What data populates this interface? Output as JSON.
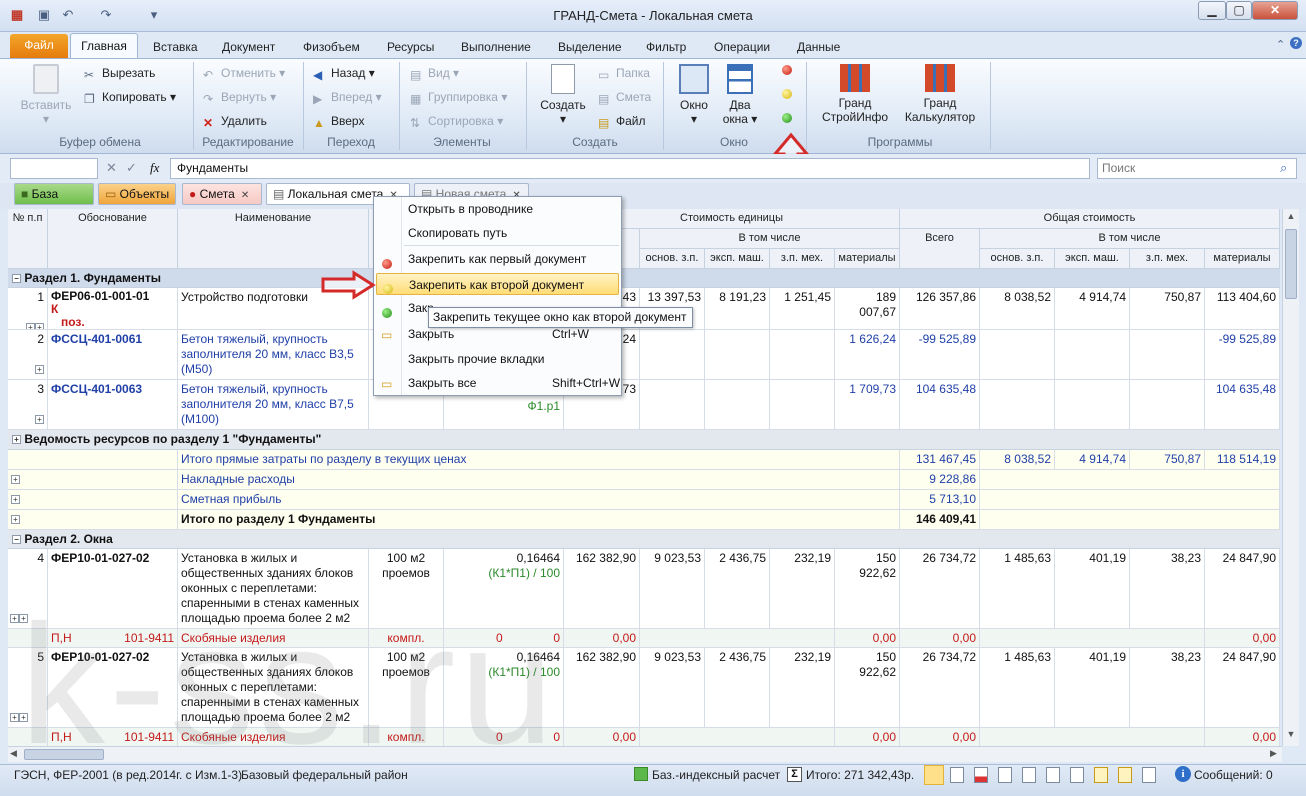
{
  "window": {
    "title": "ГРАНД-Смета - Локальная смета"
  },
  "ribbon_tabs": [
    "Файл",
    "Главная",
    "Вставка",
    "Документ",
    "Физобъем",
    "Ресурсы",
    "Выполнение",
    "Выделение",
    "Фильтр",
    "Операции",
    "Данные"
  ],
  "ribbon": {
    "clipboard": {
      "paste": "Вставить",
      "cut": "Вырезать",
      "copy": "Копировать",
      "label": "Буфер обмена"
    },
    "edit": {
      "undo": "Отменить",
      "redo": "Вернуть",
      "delete": "Удалить",
      "label": "Редактирование"
    },
    "nav": {
      "back": "Назад",
      "forward": "Вперед",
      "up": "Вверх",
      "label": "Переход"
    },
    "elements": {
      "view": "Вид",
      "group": "Группировка",
      "sort": "Сортировка",
      "label": "Элементы"
    },
    "create": {
      "create": "Создать",
      "folder": "Папка",
      "estimate": "Смета",
      "file": "Файл",
      "label": "Создать"
    },
    "window": {
      "window": "Окно",
      "two_line1": "Два",
      "two_line2": "окна",
      "label": "Окно"
    },
    "programs": {
      "stroy_line1": "Гранд",
      "stroy_line2": "СтройИнфо",
      "calc_line1": "Гранд",
      "calc_line2": "Калькулятор",
      "label": "Программы"
    }
  },
  "formula": {
    "value": "Фундаменты",
    "fx": "fx",
    "search_placeholder": "Поиск"
  },
  "doc_tabs": {
    "base": "База",
    "objects": "Объекты",
    "smeta": "Смета",
    "local": "Локальная смета",
    "new": "Новая смета"
  },
  "headers": {
    "num": "№ п.п",
    "basis": "Обоснование",
    "name": "Наименование",
    "unit_cost": "Стоимость единицы",
    "total_cost": "Общая стоимость",
    "incl": "В том числе",
    "total": "Всего",
    "osn": "основ. з.п.",
    "eksp": "эксп. маш.",
    "zpmeh": "з.п. мех.",
    "mat": "материалы"
  },
  "sections": {
    "s1": "Раздел 1. Фундаменты",
    "res1": "Ведомость ресурсов по разделу 1 \"Фундаменты\"",
    "s2": "Раздел 2. Окна"
  },
  "rows": {
    "r1": {
      "n": "1",
      "code": "ФЕР06-01-001-01",
      "k": "К",
      "poz": "поз.",
      "name": "Устройство подготовки",
      "u": "5,43",
      "o": "13 397,53",
      "e": "8 191,23",
      "z": "1 251,45",
      "m": "189 007,67",
      "t": "126 357,86",
      "to": "8 038,52",
      "te": "4 914,74",
      "tz": "750,87",
      "tm": "113 404,60"
    },
    "r2": {
      "n": "2",
      "code": "ФССЦ-401-0061",
      "name": "Бетон тяжелый, крупность заполнителя 20 мм, класс В3,5 (М50)",
      "u": "6,24",
      "m": "1 626,24",
      "t": "-99 525,89",
      "tm": "-99 525,89"
    },
    "r3": {
      "n": "3",
      "code": "ФССЦ-401-0063",
      "name": "Бетон тяжелый, крупность заполнителя 20 мм, класс В7,5 (М100)",
      "f": "Ф1.р1",
      "u": "9,73",
      "m": "1 709,73",
      "t": "104 635,48",
      "tm": "104 635,48"
    },
    "sum1": {
      "name": "Итого прямые затраты по разделу в текущих ценах",
      "t": "131 467,45",
      "to": "8 038,52",
      "te": "4 914,74",
      "tz": "750,87",
      "tm": "118 514,19"
    },
    "sum2": {
      "name": "Накладные расходы",
      "t": "9 228,86"
    },
    "sum3": {
      "name": "Сметная прибыль",
      "t": "5 713,10"
    },
    "sum4": {
      "name": "Итого по разделу 1 Фундаменты",
      "t": "146 409,41"
    },
    "r4": {
      "n": "4",
      "code": "ФЕР10-01-027-02",
      "name": "Установка в жилых и общественных зданиях блоков оконных с переплетами: спаренными в стенах каменных площадью проема более 2 м2",
      "unit": "100 м2 проемов",
      "q": "0,16464",
      "qf": "(К1*П1) / 100",
      "u": "162 382,90",
      "o": "9 023,53",
      "e": "2 436,75",
      "z": "232,19",
      "m": "150 922,62",
      "t": "26 734,72",
      "to": "1 485,63",
      "te": "401,19",
      "tz": "38,23",
      "tm": "24 847,90"
    },
    "p4": {
      "pn": "П,Н",
      "code": "101-9411",
      "name": "Скобяные изделия",
      "unit": "компл.",
      "q": "0",
      "q2": "0",
      "u": "0,00",
      "m": "0,00",
      "t": "0,00",
      "tm": "0,00"
    },
    "r5": {
      "n": "5",
      "code": "ФЕР10-01-027-02",
      "name": "Установка в жилых и общественных зданиях блоков оконных с переплетами: спаренными в стенах каменных площадью проема более 2 м2",
      "unit": "100 м2 проемов",
      "q": "0,16464",
      "qf": "(К1*П1) / 100",
      "u": "162 382,90",
      "o": "9 023,53",
      "e": "2 436,75",
      "z": "232,19",
      "m": "150 922,62",
      "t": "26 734,72",
      "to": "1 485,63",
      "te": "401,19",
      "tz": "38,23",
      "tm": "24 847,90"
    },
    "p5": {
      "pn": "П,Н",
      "code": "101-9411",
      "name": "Скобяные изделия",
      "unit": "компл.",
      "q": "0",
      "q2": "0",
      "u": "0,00",
      "m": "0,00",
      "t": "0,00",
      "tm": "0,00"
    }
  },
  "context_menu": {
    "open_explorer": "Открыть в проводнике",
    "copy_path": "Скопировать путь",
    "pin_first": "Закрепить как первый документ",
    "pin_second": "Закрепить как второй документ",
    "pin_third_partial": "Закр",
    "close": "Закрыть",
    "close_sc": "Ctrl+W",
    "close_others": "Закрыть прочие вкладки",
    "close_all": "Закрыть все",
    "close_all_sc": "Shift+Ctrl+W"
  },
  "tooltip": "Закрепить текущее окно как второй документ",
  "watermark": "k-ss.ru",
  "status": {
    "norms": "ГЭСН, ФЕР-2001 (в ред.2014г. с Изм.1-3)",
    "region": "Базовый федеральный район",
    "calc": "Баз.-индексный расчет",
    "total": "Итого: 271 342,43р.",
    "messages": "Сообщений: 0"
  },
  "colors": {
    "accent": "#1f3fa6",
    "file_tab": "#e88a14",
    "alert_arrow": "#d42a2a"
  }
}
